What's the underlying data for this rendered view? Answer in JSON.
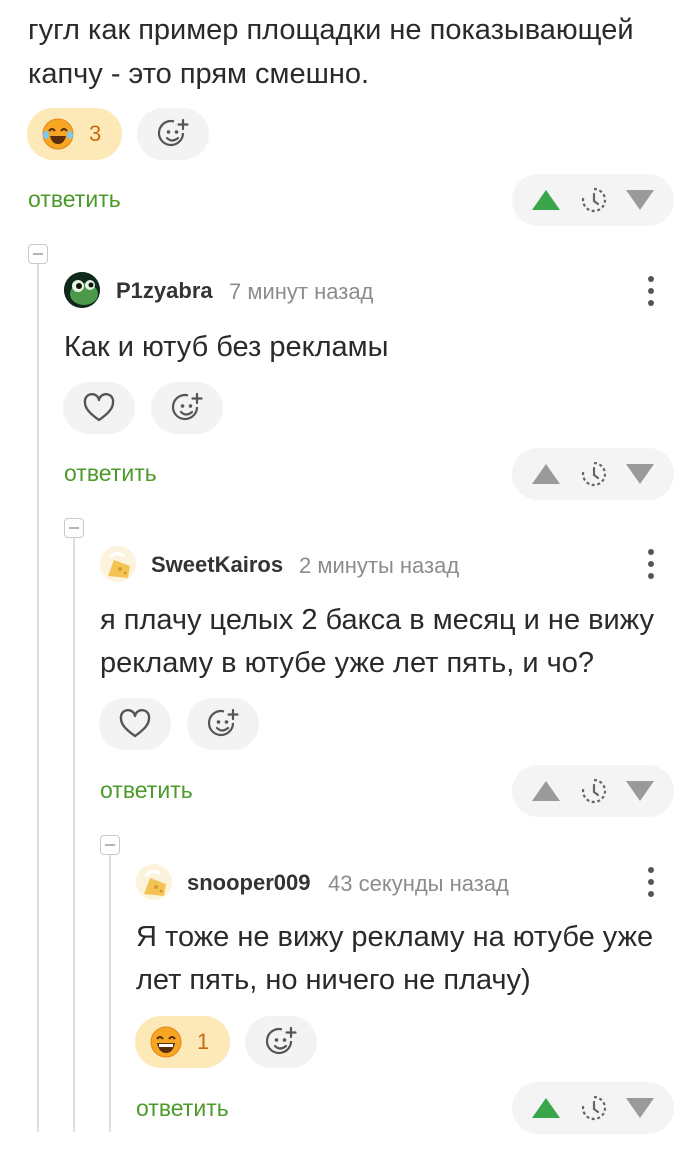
{
  "top_comment": {
    "text_line1": "гугл как пример площадки не показывающей",
    "text_line2": "капчу - это прям смешно.",
    "reaction_count": "3",
    "reply_label": "ответить"
  },
  "comments": [
    {
      "author": "P1zyabra",
      "time": "7 минут назад",
      "text_line1": "Как и ютуб без рекламы",
      "reply_label": "ответить"
    },
    {
      "author": "SweetKairos",
      "time": "2 минуты назад",
      "text_line1": "я плачу целых 2 бакса в месяц и не вижу",
      "text_line2": "рекламу в ютубе уже лет пять, и чо?",
      "reply_label": "ответить"
    },
    {
      "author": "snooper009",
      "time": "43 секунды назад",
      "text_line1": "Я тоже не вижу рекламу на ютубе уже",
      "text_line2": "лет пять, но ничего не плачу)",
      "reaction_count": "1",
      "reply_label": "ответить"
    }
  ],
  "icons": [
    "laughing-face-icon",
    "add-reaction-icon",
    "heart-icon",
    "vote-up-icon",
    "vote-pending-icon",
    "vote-down-icon",
    "more-icon",
    "collapse-icon"
  ],
  "colors": {
    "accent_green": "#4c9a2a",
    "vote_up_active": "#3aa64a",
    "reaction_bg": "#fde9b8"
  }
}
